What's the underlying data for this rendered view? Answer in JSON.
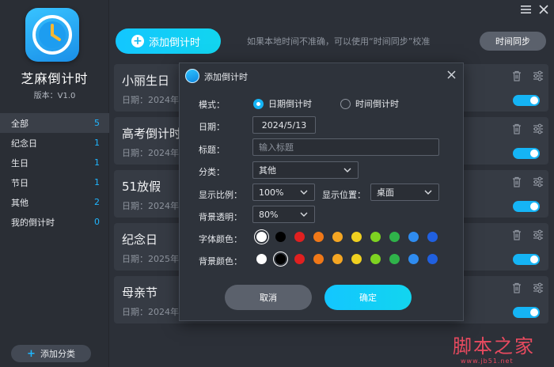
{
  "app": {
    "name": "芝麻倒计时",
    "version": "版本：V1.0"
  },
  "sidebar": {
    "items": [
      {
        "label": "全部",
        "count": "5"
      },
      {
        "label": "纪念日",
        "count": "1"
      },
      {
        "label": "生日",
        "count": "1"
      },
      {
        "label": "节日",
        "count": "1"
      },
      {
        "label": "其他",
        "count": "2"
      },
      {
        "label": "我的倒计时",
        "count": "0"
      }
    ],
    "add_label": "添加分类"
  },
  "top": {
    "add_button": "添加倒计时",
    "hint": "如果本地时间不准确，可以使用“时间同步”校准",
    "sync_button": "时间同步"
  },
  "cards": [
    {
      "title": "小丽生日",
      "date": "日期：2024年"
    },
    {
      "title": "高考倒计时",
      "date": "日期：2024年"
    },
    {
      "title": "51放假",
      "date": "日期：2024年"
    },
    {
      "title": "纪念日",
      "date": "日期：2025年"
    },
    {
      "title": "母亲节",
      "date": "日期：2024年"
    }
  ],
  "dialog": {
    "title": "添加倒计时",
    "mode_label": "模式：",
    "mode_options": [
      "日期倒计时",
      "时间倒计时"
    ],
    "date_label": "日期：",
    "date_value": "2024/5/13",
    "title_label": "标题：",
    "title_placeholder": "输入标题",
    "category_label": "分类：",
    "category_value": "其他",
    "scale_label": "显示比例：",
    "scale_value": "100%",
    "position_label": "显示位置：",
    "position_value": "桌面",
    "opacity_label": "背景透明：",
    "opacity_value": "80%",
    "font_color_label": "字体颜色：",
    "bg_color_label": "背景颜色：",
    "cancel": "取消",
    "confirm": "确定"
  },
  "colors": {
    "accent": "#15b4f5",
    "swatches": [
      "#ffffff",
      "#000000",
      "#e02020",
      "#f07818",
      "#f5a623",
      "#f0d020",
      "#7ed321",
      "#2fb34a",
      "#2f8cf0",
      "#2060e0"
    ]
  },
  "watermark": {
    "text": "脚本之家",
    "url": "www.jb51.net"
  }
}
